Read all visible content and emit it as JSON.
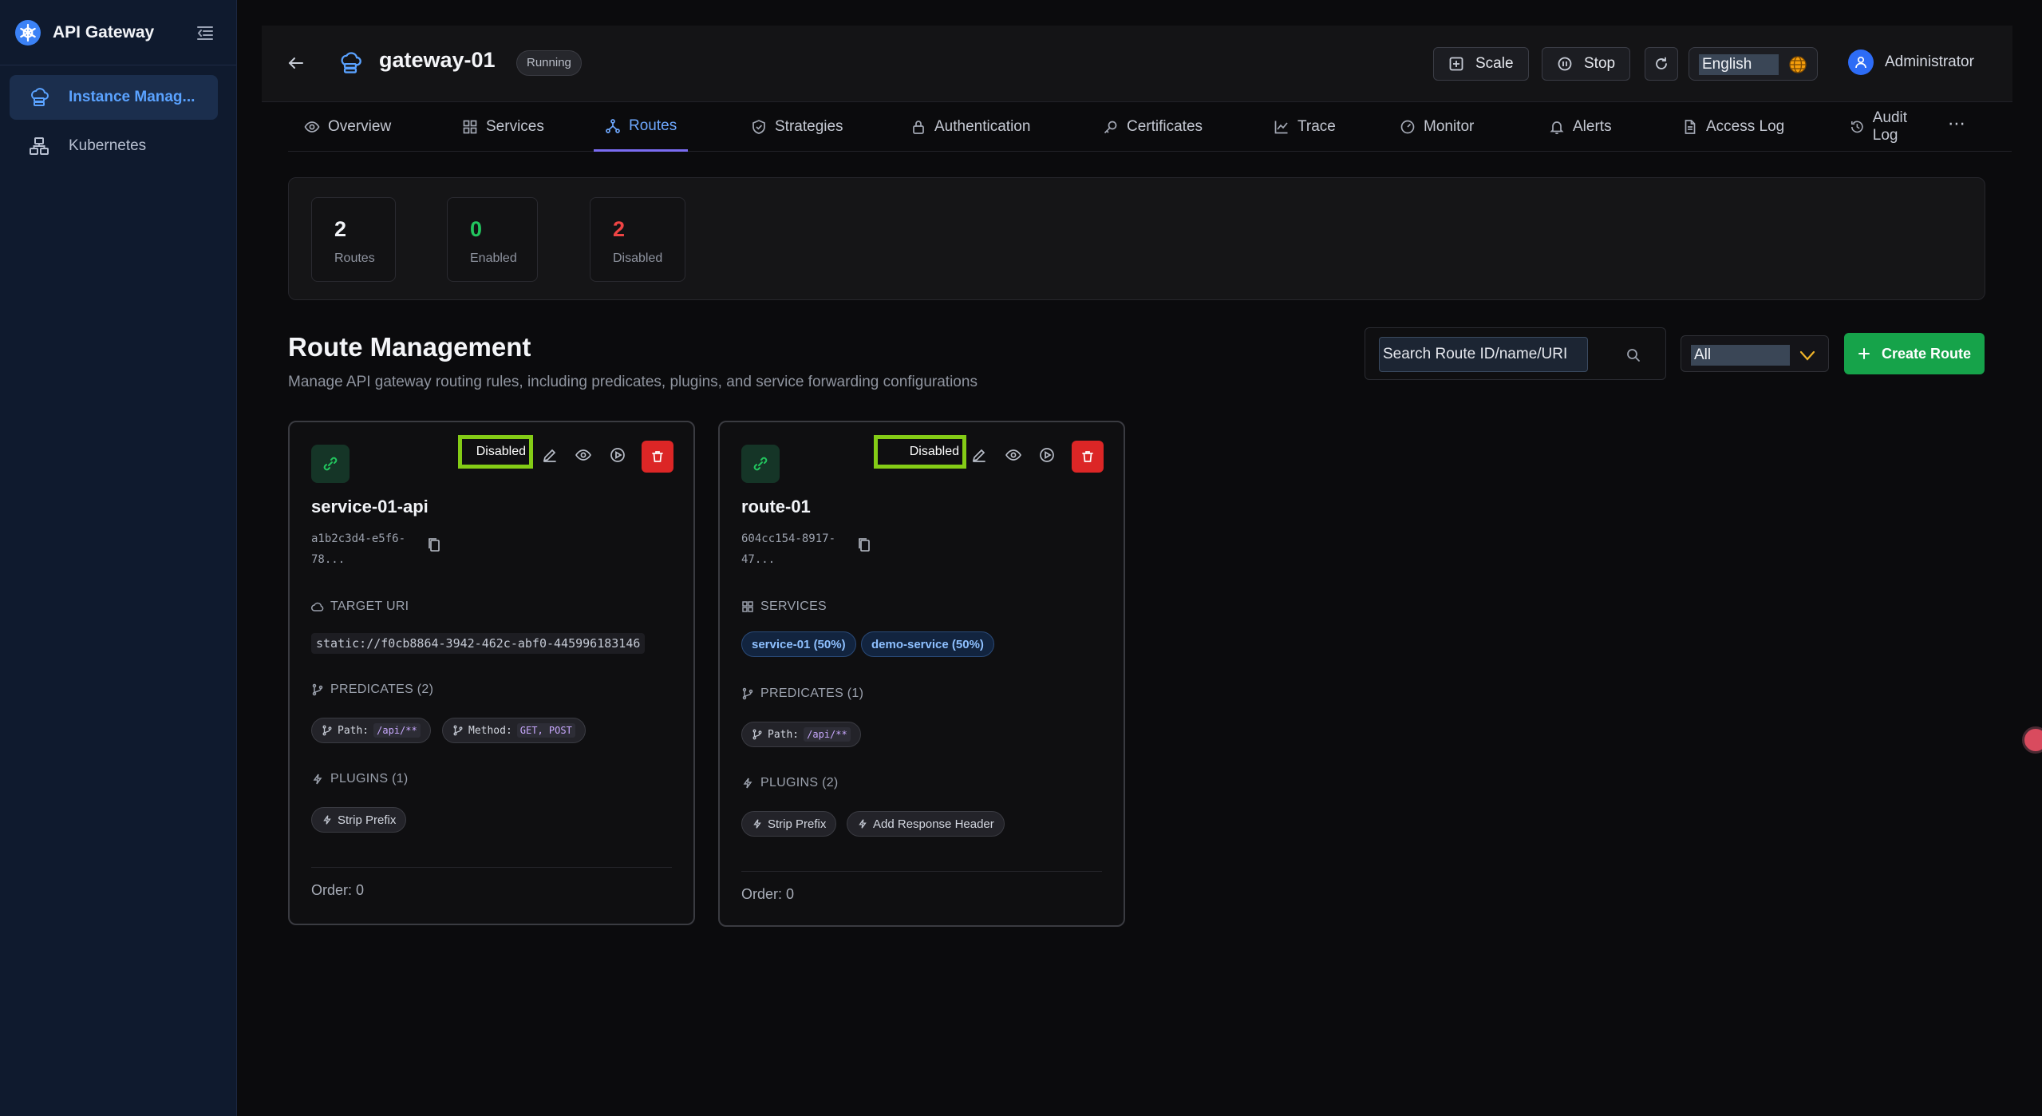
{
  "app": {
    "title": "API Gateway"
  },
  "sidebar": {
    "items": [
      {
        "label": "Instance Manag...",
        "icon": "cloud-server-icon",
        "active": true
      },
      {
        "label": "Kubernetes",
        "icon": "cluster-icon",
        "active": false
      }
    ]
  },
  "header": {
    "gateway_name": "gateway-01",
    "status": "Running",
    "scale_label": "Scale",
    "stop_label": "Stop",
    "language": "English",
    "user": "Administrator"
  },
  "tabs": [
    {
      "label": "Overview",
      "icon": "eye-icon"
    },
    {
      "label": "Services",
      "icon": "grid-icon"
    },
    {
      "label": "Routes",
      "icon": "routes-icon",
      "active": true
    },
    {
      "label": "Strategies",
      "icon": "shield-icon"
    },
    {
      "label": "Authentication",
      "icon": "lock-icon"
    },
    {
      "label": "Certificates",
      "icon": "key-icon"
    },
    {
      "label": "Trace",
      "icon": "trace-icon"
    },
    {
      "label": "Monitor",
      "icon": "gauge-icon"
    },
    {
      "label": "Alerts",
      "icon": "bell-icon"
    },
    {
      "label": "Access Log",
      "icon": "file-icon"
    },
    {
      "label": "Audit Log",
      "icon": "history-icon"
    }
  ],
  "stats": [
    {
      "value": "2",
      "label": "Routes",
      "color": "#f2f4f8"
    },
    {
      "value": "0",
      "label": "Enabled",
      "color": "#22c55e"
    },
    {
      "value": "2",
      "label": "Disabled",
      "color": "#ef4444"
    }
  ],
  "section": {
    "title": "Route Management",
    "subtitle": "Manage API gateway routing rules, including predicates, plugins, and service forwarding configurations"
  },
  "search": {
    "placeholder": "Search Route ID/name/URI"
  },
  "filter": {
    "value": "All"
  },
  "create_label": "Create Route",
  "routes": [
    {
      "status": "Disabled",
      "name": "service-01-api",
      "id": "a1b2c3d4-e5f6-78...",
      "target_label": "TARGET URI",
      "target_uri": "static://f0cb8864-3942-462c-abf0-445996183146",
      "predicates_label": "PREDICATES (2)",
      "predicates": [
        {
          "key": "Path:",
          "value": "/api/**"
        },
        {
          "key": "Method:",
          "value": "GET, POST"
        }
      ],
      "plugins_label": "PLUGINS (1)",
      "plugins": [
        "Strip Prefix"
      ],
      "order": "Order: 0"
    },
    {
      "status": "Disabled",
      "name": "route-01",
      "id": "604cc154-8917-47...",
      "services_label": "SERVICES",
      "services": [
        "service-01 (50%)",
        "demo-service (50%)"
      ],
      "predicates_label": "PREDICATES (1)",
      "predicates": [
        {
          "key": "Path:",
          "value": "/api/**"
        }
      ],
      "plugins_label": "PLUGINS (2)",
      "plugins": [
        "Strip Prefix",
        "Add Response Header"
      ],
      "order": "Order: 0"
    }
  ],
  "colors": {
    "accent": "#5aa2ff",
    "create": "#16a34a",
    "delete": "#dc2626",
    "highlight": "#84cc16"
  }
}
